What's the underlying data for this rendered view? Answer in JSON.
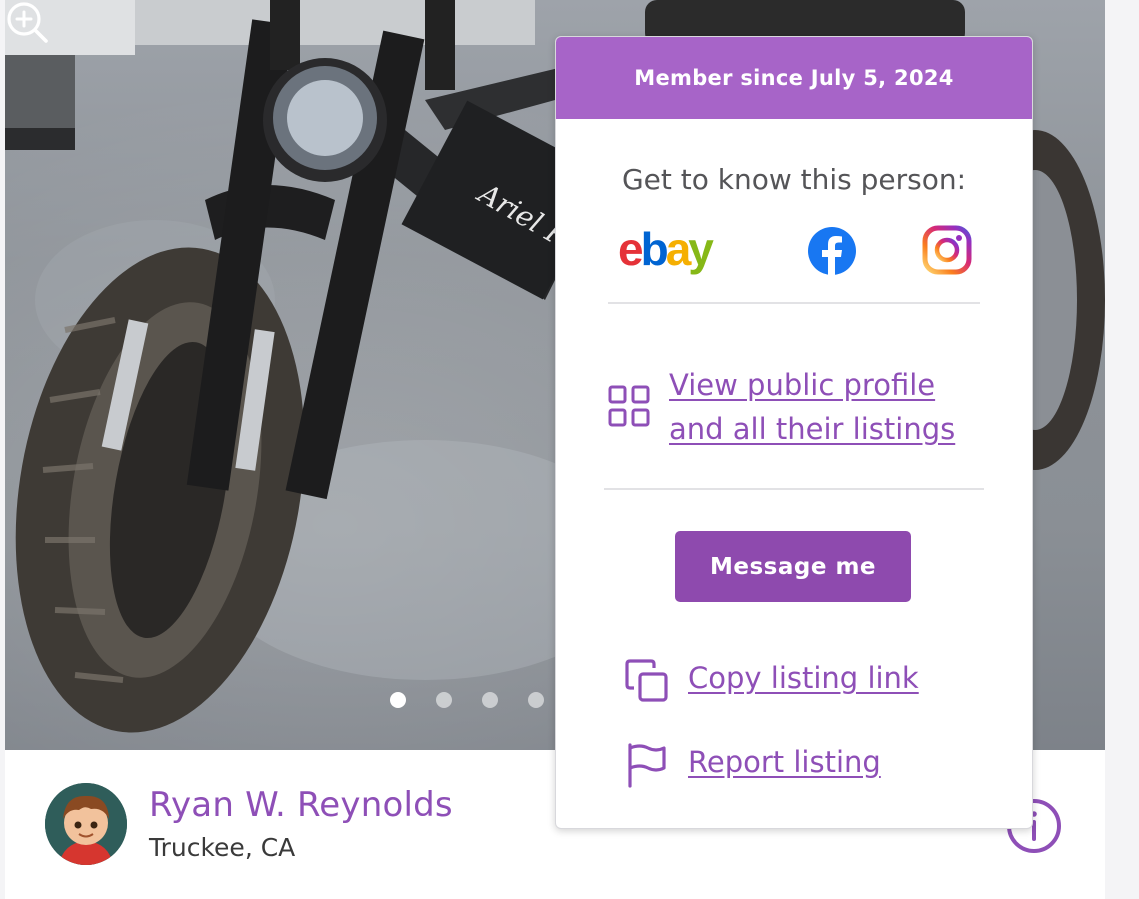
{
  "popover": {
    "member_since": "Member since July 5, 2024",
    "heading": "Get to know this person:",
    "social": {
      "ebay_label": "ebay",
      "ebay_colors": [
        "#e53238",
        "#0064d2",
        "#f5af02",
        "#86b817"
      ],
      "facebook_color": "#1877f2",
      "instagram_colors": [
        "#feda75",
        "#fa7e1e",
        "#d62976",
        "#962fbf",
        "#4f5bd5"
      ]
    },
    "profile_link_line1": "View public profile",
    "profile_link_line2": "and all their listings",
    "message_button": "Message me",
    "copy_link": "Copy listing link",
    "report_listing": "Report listing"
  },
  "seller": {
    "name": "Ryan W. Reynolds",
    "location": "Truckee, CA"
  },
  "gallery": {
    "active_index": 0
  },
  "colors": {
    "accent_purple": "#8e4fb7",
    "header_purple": "#a764c8",
    "button_purple": "#8e4aae"
  }
}
